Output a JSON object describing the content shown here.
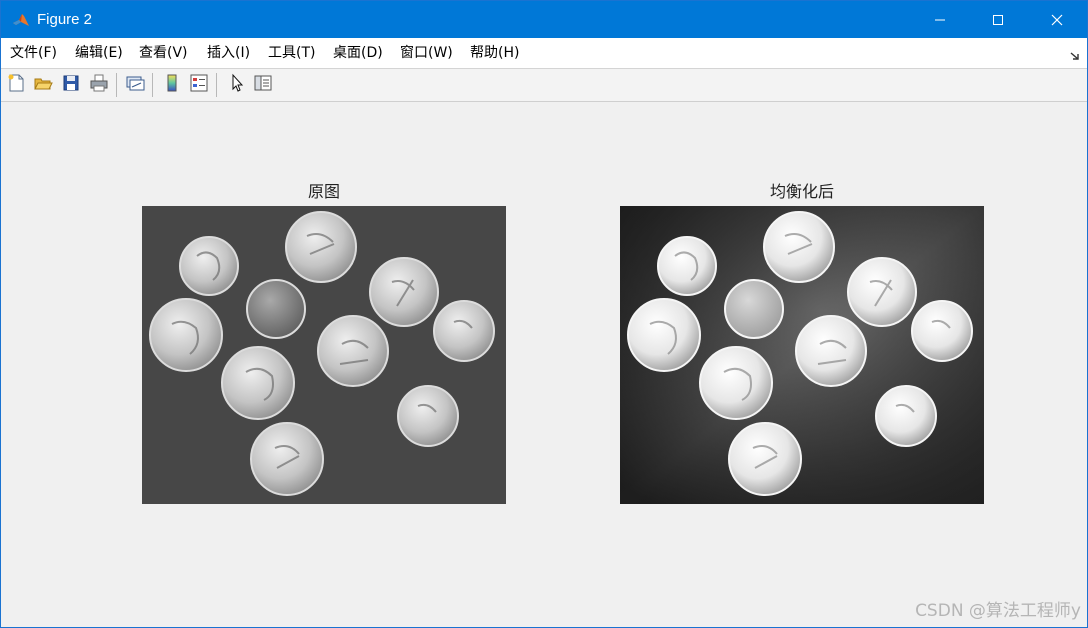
{
  "window": {
    "title": "Figure 2",
    "accent_color": "#0078d7",
    "controls": [
      "minimize-icon",
      "maximize-icon",
      "close-icon"
    ]
  },
  "menu": {
    "items": [
      "文件(F)",
      "编辑(E)",
      "查看(V)",
      "插入(I)",
      "工具(T)",
      "桌面(D)",
      "窗口(W)",
      "帮助(H)"
    ]
  },
  "toolbar": {
    "buttons": [
      "new-figure-icon",
      "open-file-icon",
      "save-icon",
      "print-icon",
      "link-plot-icon",
      "colorbar-icon",
      "legend-icon",
      "edit-plot-arrow-icon",
      "property-inspector-icon"
    ]
  },
  "axes": [
    {
      "title": "原图",
      "image": "grayscale coins image"
    },
    {
      "title": "均衡化后",
      "image": "histogram-equalized coins image"
    }
  ],
  "watermark": "CSDN @算法工程师y"
}
